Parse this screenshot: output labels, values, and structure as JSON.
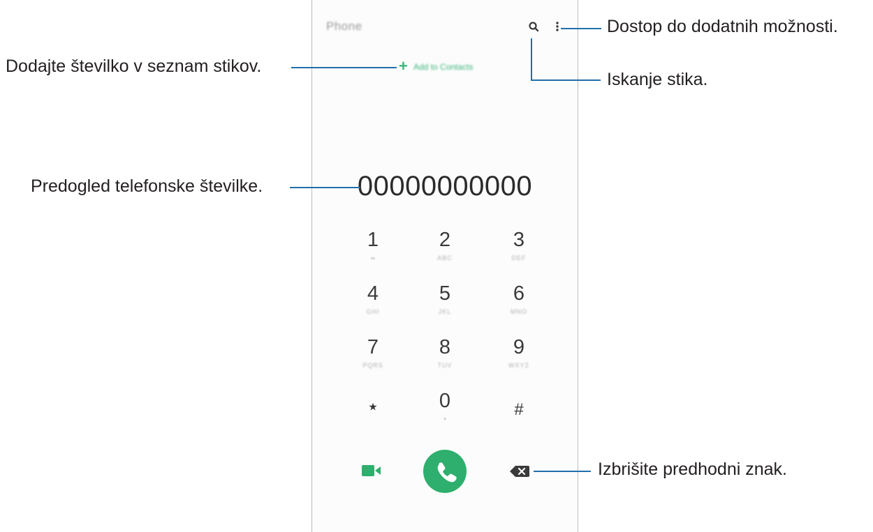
{
  "phone": {
    "title": "Phone",
    "add_to_contacts": "Add to Contacts",
    "number": "00000000000",
    "keys": [
      {
        "digit": "1",
        "sub": "∞"
      },
      {
        "digit": "2",
        "sub": "ABC"
      },
      {
        "digit": "3",
        "sub": "DEF"
      },
      {
        "digit": "4",
        "sub": "GHI"
      },
      {
        "digit": "5",
        "sub": "JKL"
      },
      {
        "digit": "6",
        "sub": "MNO"
      },
      {
        "digit": "7",
        "sub": "PQRS"
      },
      {
        "digit": "8",
        "sub": "TUV"
      },
      {
        "digit": "9",
        "sub": "WXYZ"
      },
      {
        "digit": "⋆",
        "sub": ""
      },
      {
        "digit": "0",
        "sub": "+"
      },
      {
        "digit": "#",
        "sub": ""
      }
    ],
    "icons": {
      "search": "search-icon",
      "more": "more-options-icon",
      "add": "plus-icon",
      "video": "video-call-icon",
      "call": "phone-call-icon",
      "backspace": "backspace-icon"
    },
    "colors": {
      "accent": "#2eaf6d",
      "leader": "#1f6fad"
    }
  },
  "callouts": {
    "more_options": "Dostop do dodatnih možnosti.",
    "search_contact": "Iskanje stika.",
    "add_number": "Dodajte številko v seznam stikov.",
    "number_preview": "Predogled telefonske številke.",
    "delete_char": "Izbrišite predhodni znak."
  }
}
